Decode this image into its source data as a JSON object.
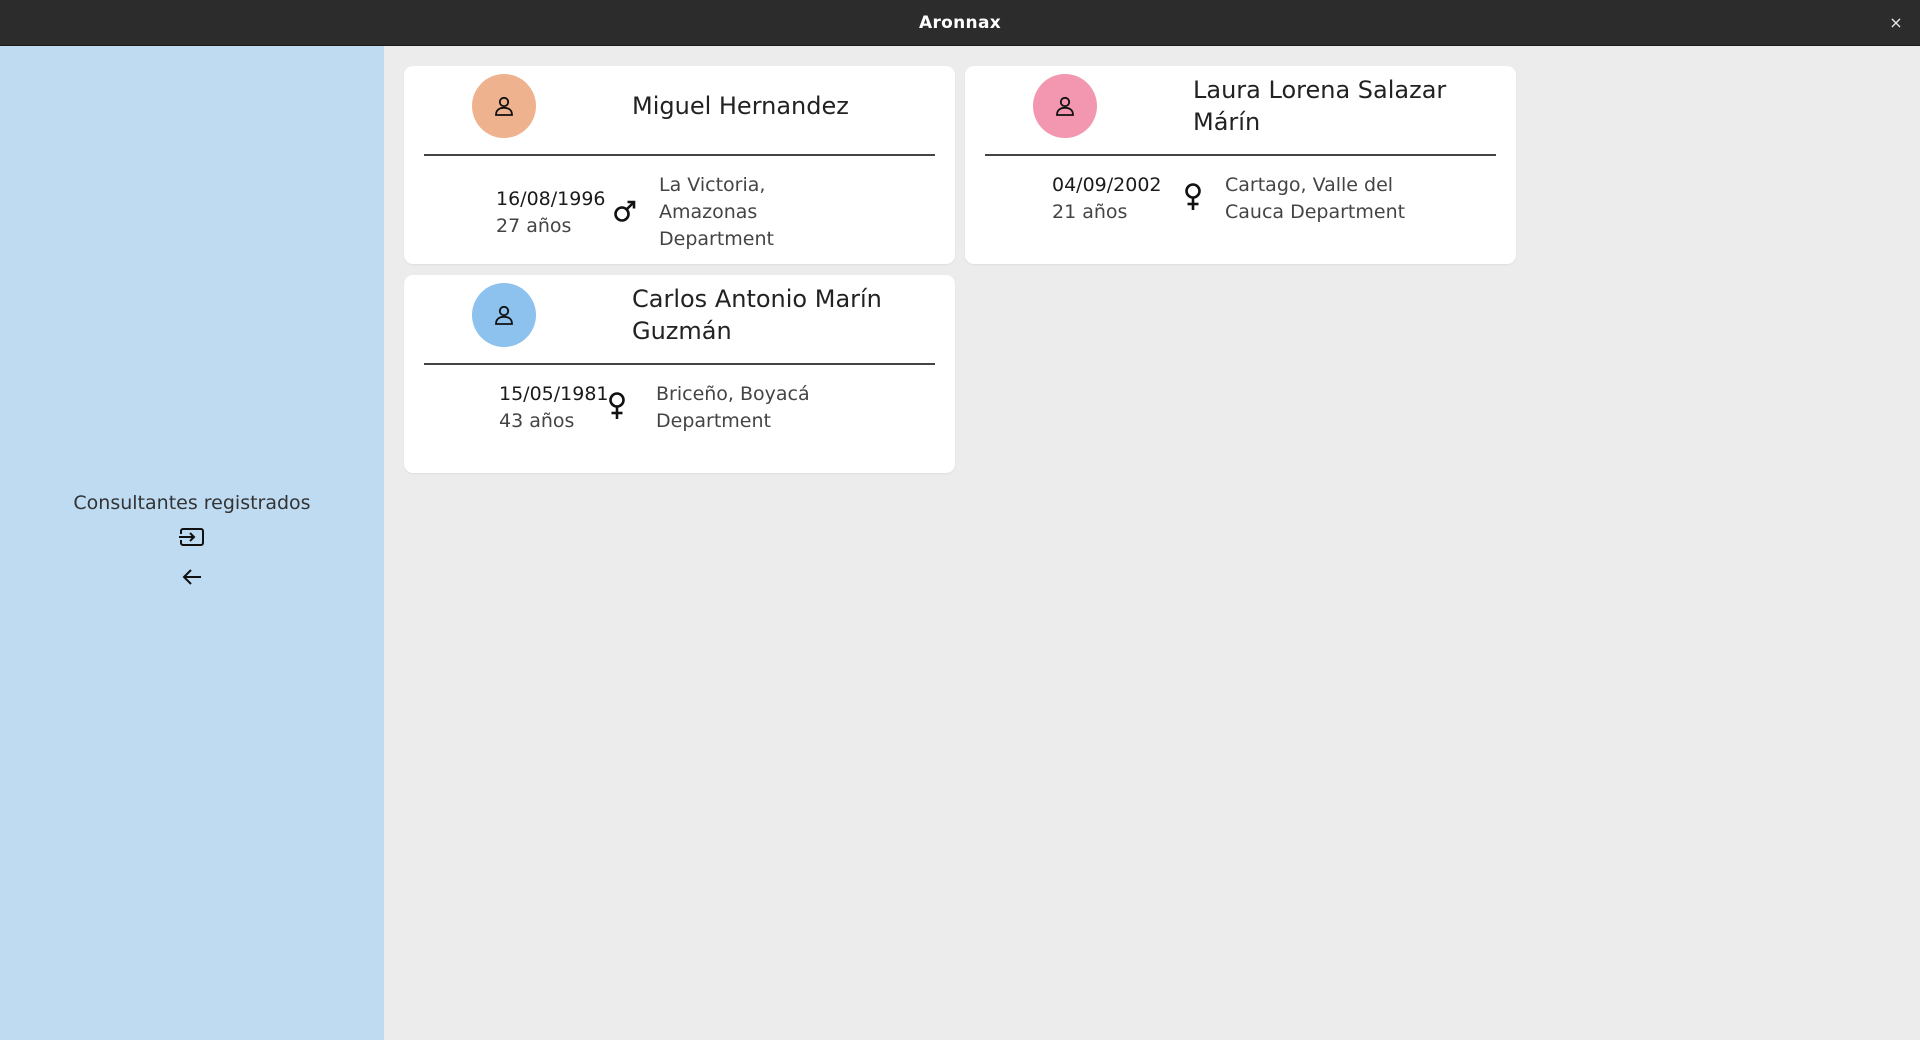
{
  "window": {
    "title": "Aronnax",
    "close_glyph": "×"
  },
  "sidebar": {
    "label": "Consultantes registrados",
    "login_icon": "login-icon",
    "back_icon": "arrow-left-icon"
  },
  "cards": [
    {
      "name_line1": "Miguel Hernandez",
      "name_line2": "",
      "avatar_color": "#efb28f",
      "birth_date": "16/08/1996",
      "age": "27 años",
      "gender_icon": "male-icon",
      "place_lines": [
        "La Victoria,",
        "Amazonas",
        "Department"
      ]
    },
    {
      "name_line1": "Laura Lorena Salazar",
      "name_line2": "Márín",
      "avatar_color": "#f297af",
      "birth_date": "04/09/2002",
      "age": "21 años",
      "gender_icon": "female-icon",
      "place_lines": [
        "Cartago, Valle del",
        "Cauca Department"
      ]
    },
    {
      "name_line1": "Carlos Antonio Marín",
      "name_line2": "Guzmán",
      "avatar_color": "#8dc1ee",
      "birth_date": "15/05/1981",
      "age": "43 años",
      "gender_icon": "female-icon",
      "place_lines": [
        "Briceño, Boyacá",
        "Department"
      ]
    }
  ]
}
